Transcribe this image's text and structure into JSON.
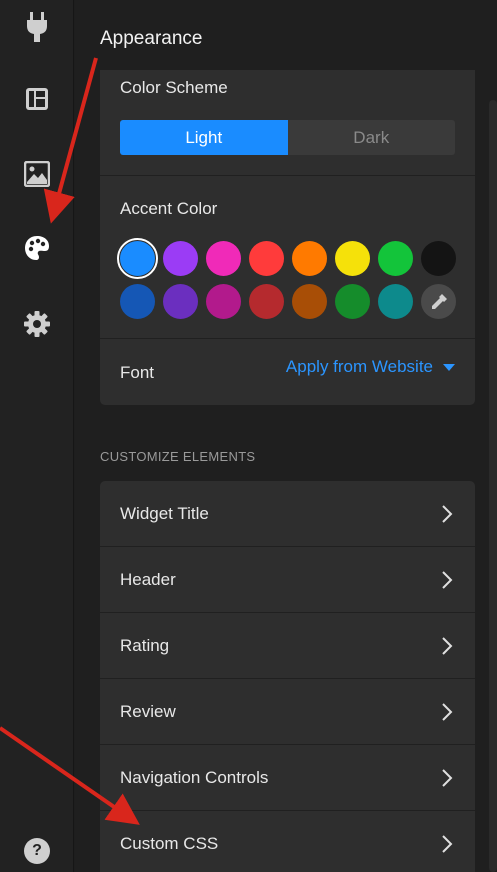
{
  "rail": {
    "icons": [
      "plug-icon",
      "layout-icon",
      "image-icon",
      "palette-icon",
      "gear-icon"
    ],
    "help_label": "?"
  },
  "panel": {
    "title": "Appearance",
    "color_scheme": {
      "label": "Color Scheme",
      "options": [
        "Light",
        "Dark"
      ],
      "selected": "Light"
    },
    "accent": {
      "label": "Accent Color",
      "row1": [
        "#1a8cff",
        "#9b3cf5",
        "#f02ab8",
        "#ff3b3b",
        "#ff7a00",
        "#f5e10a",
        "#13c43a",
        "#141414"
      ],
      "row2": [
        "#1557b5",
        "#6b2fbf",
        "#b21a8c",
        "#b52a2e",
        "#a84e06",
        "#158c2b",
        "#0d8a8c"
      ],
      "picker_icon": "eyedropper-icon",
      "selected_index": 0
    },
    "font": {
      "label": "Font",
      "value": "Apply from Website"
    }
  },
  "customize": {
    "heading": "CUSTOMIZE ELEMENTS",
    "items": [
      "Widget Title",
      "Header",
      "Rating",
      "Review",
      "Navigation Controls",
      "Custom CSS"
    ]
  },
  "colors": {
    "accent_blue": "#1a8cff",
    "link_blue": "#2b95ff",
    "annotation_red": "#d9261c"
  }
}
